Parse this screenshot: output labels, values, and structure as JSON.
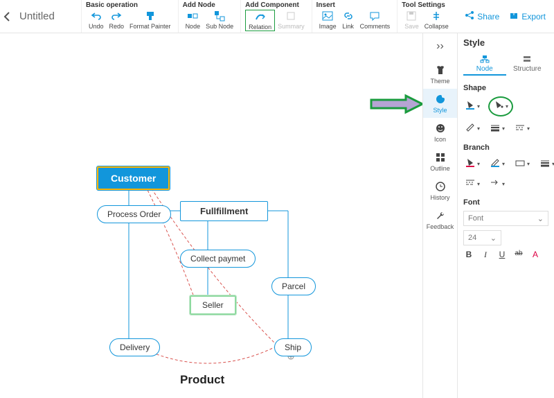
{
  "title": "Untitled",
  "toolbar": {
    "groups": {
      "basic": {
        "label": "Basic operation",
        "undo": "Undo",
        "redo": "Redo",
        "format_painter": "Format Painter"
      },
      "add_node": {
        "label": "Add Node",
        "node": "Node",
        "sub_node": "Sub Node"
      },
      "add_component": {
        "label": "Add Component",
        "relation": "Relation",
        "summary": "Summary"
      },
      "insert": {
        "label": "Insert",
        "image": "Image",
        "link": "Link",
        "comments": "Comments"
      },
      "tool_settings": {
        "label": "Tool Settings",
        "save": "Save",
        "collapse": "Collapse"
      }
    },
    "share": "Share",
    "export": "Export"
  },
  "canvas": {
    "customer": "Customer",
    "process_order": "Process Order",
    "fulfillment": "Fullfillment",
    "collect_payment": "Collect paymet",
    "seller": "Seller",
    "parcel": "Parcel",
    "delivery": "Delivery",
    "ship": "Ship",
    "product": "Product"
  },
  "rail": {
    "theme": "Theme",
    "style": "Style",
    "icon": "Icon",
    "outline": "Outline",
    "history": "History",
    "feedback": "Feedback"
  },
  "panel": {
    "title": "Style",
    "tab_node": "Node",
    "tab_structure": "Structure",
    "shape": "Shape",
    "branch": "Branch",
    "font": "Font",
    "font_value": "Font",
    "font_size": "24"
  }
}
